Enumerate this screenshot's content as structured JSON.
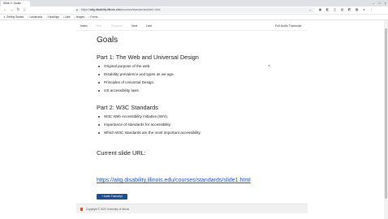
{
  "browser": {
    "tab_title": "Slide 1: Goals",
    "window_controls": [
      "–",
      "□",
      "×"
    ],
    "url_prefix": "https://",
    "url_host": "aitg.disability.illinois.edu",
    "url_path": "/courses/standards/slide1.html",
    "bookmarks": [
      {
        "icon": "star-icon",
        "label": "Getting Started"
      },
      {
        "icon": "folder-icon",
        "label": "Landmarks"
      },
      {
        "icon": "folder-icon",
        "label": "Headings"
      },
      {
        "icon": "folder-icon",
        "label": "Lists"
      },
      {
        "icon": "folder-icon",
        "label": "Images"
      },
      {
        "icon": "folder-icon",
        "label": "Forms"
      }
    ]
  },
  "slide_nav": {
    "index": "Index",
    "first": "First",
    "previous": "Previous",
    "next": "Next",
    "last": "Last",
    "full_transcript": "Full Audio Transcript"
  },
  "page": {
    "title": "Goals",
    "part1_heading": "Part 1: The Web and Universal Design",
    "part1_items": [
      "Original purpose of the web.",
      "Disability prevalence and types as we age.",
      "Principles of Universal Design.",
      "US accessibility laws."
    ],
    "part2_heading": "Part 2: W3C Standards",
    "part2_items": [
      "W3C Web Accessibility Initiative (WAI).",
      "Importance of standards for accessibility.",
      "Which W3C standards are the most important accessibility."
    ],
    "current_url_heading": "Current slide URL:",
    "current_url": "https://aitg.disability.illinois.edu/courses/standards/slide1.html",
    "audio_button": "+ Audio Transcript",
    "footer": "Copyright © 2020 University of Illinois"
  },
  "colors": {
    "link": "#1155cc",
    "button": "#1f4d8c",
    "illinois_orange": "#e84a27"
  }
}
